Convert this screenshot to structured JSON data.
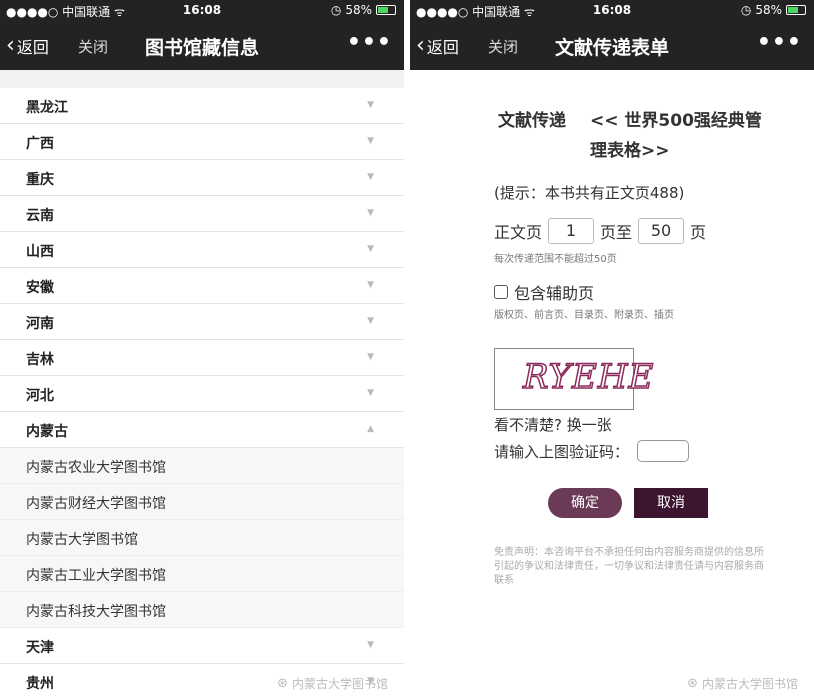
{
  "status": {
    "carrier": "●●●●○ 中国联通 ᯤ",
    "time": "16:08",
    "battery": "58%"
  },
  "left": {
    "nav": {
      "back": "返回",
      "close": "关闭",
      "title": "图书馆藏信息",
      "more": "•••"
    },
    "provinces_top": [
      "黑龙江",
      "广西",
      "重庆",
      "云南",
      "山西",
      "安徽",
      "河南",
      "吉林",
      "河北"
    ],
    "expanded": "内蒙古",
    "libraries": [
      "内蒙古农业大学图书馆",
      "内蒙古财经大学图书馆",
      "内蒙古大学图书馆",
      "内蒙古工业大学图书馆",
      "内蒙古科技大学图书馆"
    ],
    "provinces_bottom": [
      "天津",
      "贵州"
    ],
    "watermark": "内蒙古大学图书馆"
  },
  "right": {
    "nav": {
      "back": "返回",
      "close": "关闭",
      "title": "文献传递表单",
      "more": "•••"
    },
    "form_label": "文献传递",
    "book_title": "<< 世界500强经典管理表格>>",
    "hint": "(提示：本书共有正文页488)",
    "page_prefix": "正文页",
    "page_from": "1",
    "page_mid": "页至",
    "page_to": "50",
    "page_suffix": "页",
    "range_note": "每次传递范围不能超过50页",
    "aux_label": "包含辅助页",
    "aux_note": "版权页、前言页、目录页、附录页、插页",
    "captcha_text": "RYEHE",
    "refresh": "看不清楚? 换一张",
    "verify_label": "请输入上图验证码：",
    "ok": "确定",
    "cancel": "取消",
    "disclaimer": "免责声明：本咨询平台不承担任何由内容服务商提供的信息所引起的争议和法律责任，一切争议和法律责任请与内容服务商联系",
    "watermark": "内蒙古大学图书馆"
  }
}
